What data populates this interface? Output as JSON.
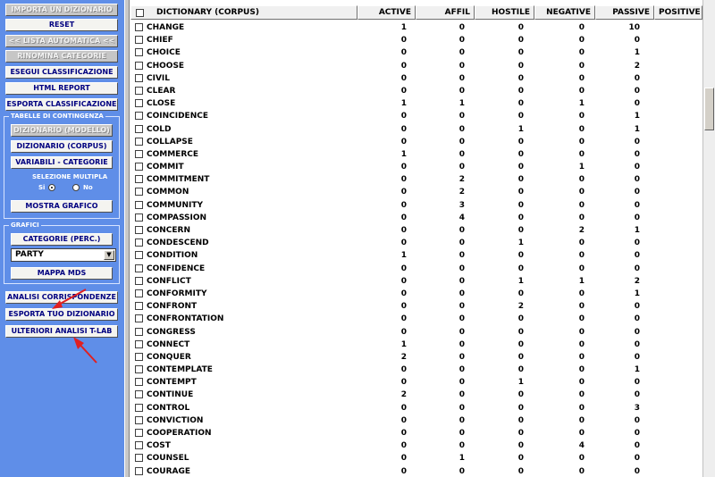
{
  "sidebar": {
    "buttons": {
      "importa": "IMPORTA UN DIZIONARIO",
      "reset": "RESET",
      "lista": "<< LISTA AUTOMATICA <<",
      "rinomina": "RINOMINA CATEGORIE",
      "esegui": "ESEGUI CLASSIFICAZIONE",
      "html": "HTML REPORT",
      "esporta_class": "ESPORTA CLASSIFICAZIONE"
    },
    "contingenza": {
      "title": "TABELLE DI CONTINGENZA",
      "modello": "DIZIONARIO (MODELLO)",
      "corpus": "DIZIONARIO (CORPUS)",
      "variabili": "VARIABILI - CATEGORIE",
      "selezione": "SELEZIONE MULTIPLA",
      "si": "Si",
      "no": "No",
      "mostra": "MOSTRA GRAFICO"
    },
    "grafici": {
      "title": "GRAFICI",
      "categorie": "CATEGORIE (PERC.)",
      "select_value": "PARTY",
      "mappa": "MAPPA  MDS"
    },
    "bottom": {
      "analisi": "ANALISI CORRISPONDENZE",
      "esporta_diz": "ESPORTA TUO DIZIONARIO",
      "ulteriori": "ULTERIORI ANALISI T-LAB"
    }
  },
  "table": {
    "headers": [
      "DICTIONARY (CORPUS)",
      "ACTIVE",
      "AFFIL",
      "HOSTILE",
      "NEGATIVE",
      "PASSIVE",
      "POSITIVE"
    ],
    "rows": [
      [
        "CHANGE",
        "1",
        "0",
        "0",
        "0",
        "10"
      ],
      [
        "CHIEF",
        "0",
        "0",
        "0",
        "0",
        "0"
      ],
      [
        "CHOICE",
        "0",
        "0",
        "0",
        "0",
        "1"
      ],
      [
        "CHOOSE",
        "0",
        "0",
        "0",
        "0",
        "2"
      ],
      [
        "CIVIL",
        "0",
        "0",
        "0",
        "0",
        "0"
      ],
      [
        "CLEAR",
        "0",
        "0",
        "0",
        "0",
        "0"
      ],
      [
        "CLOSE",
        "1",
        "1",
        "0",
        "1",
        "0"
      ],
      [
        "COINCIDENCE",
        "0",
        "0",
        "0",
        "0",
        "1"
      ],
      [
        "COLD",
        "0",
        "0",
        "1",
        "0",
        "1"
      ],
      [
        "COLLAPSE",
        "0",
        "0",
        "0",
        "0",
        "0"
      ],
      [
        "COMMERCE",
        "1",
        "0",
        "0",
        "0",
        "0"
      ],
      [
        "COMMIT",
        "0",
        "0",
        "0",
        "1",
        "0"
      ],
      [
        "COMMITMENT",
        "0",
        "2",
        "0",
        "0",
        "0"
      ],
      [
        "COMMON",
        "0",
        "2",
        "0",
        "0",
        "0"
      ],
      [
        "COMMUNITY",
        "0",
        "3",
        "0",
        "0",
        "0"
      ],
      [
        "COMPASSION",
        "0",
        "4",
        "0",
        "0",
        "0"
      ],
      [
        "CONCERN",
        "0",
        "0",
        "0",
        "2",
        "1"
      ],
      [
        "CONDESCEND",
        "0",
        "0",
        "1",
        "0",
        "0"
      ],
      [
        "CONDITION",
        "1",
        "0",
        "0",
        "0",
        "0"
      ],
      [
        "CONFIDENCE",
        "0",
        "0",
        "0",
        "0",
        "0"
      ],
      [
        "CONFLICT",
        "0",
        "0",
        "1",
        "1",
        "2"
      ],
      [
        "CONFORMITY",
        "0",
        "0",
        "0",
        "0",
        "1"
      ],
      [
        "CONFRONT",
        "0",
        "0",
        "2",
        "0",
        "0"
      ],
      [
        "CONFRONTATION",
        "0",
        "0",
        "0",
        "0",
        "0"
      ],
      [
        "CONGRESS",
        "0",
        "0",
        "0",
        "0",
        "0"
      ],
      [
        "CONNECT",
        "1",
        "0",
        "0",
        "0",
        "0"
      ],
      [
        "CONQUER",
        "2",
        "0",
        "0",
        "0",
        "0"
      ],
      [
        "CONTEMPLATE",
        "0",
        "0",
        "0",
        "0",
        "1"
      ],
      [
        "CONTEMPT",
        "0",
        "0",
        "1",
        "0",
        "0"
      ],
      [
        "CONTINUE",
        "2",
        "0",
        "0",
        "0",
        "0"
      ],
      [
        "CONTROL",
        "0",
        "0",
        "0",
        "0",
        "3"
      ],
      [
        "CONVICTION",
        "0",
        "0",
        "0",
        "0",
        "0"
      ],
      [
        "COOPERATION",
        "0",
        "0",
        "0",
        "0",
        "0"
      ],
      [
        "COST",
        "0",
        "0",
        "0",
        "4",
        "0"
      ],
      [
        "COUNSEL",
        "0",
        "1",
        "0",
        "0",
        "0"
      ],
      [
        "COURAGE",
        "0",
        "0",
        "0",
        "0",
        "0"
      ]
    ]
  }
}
